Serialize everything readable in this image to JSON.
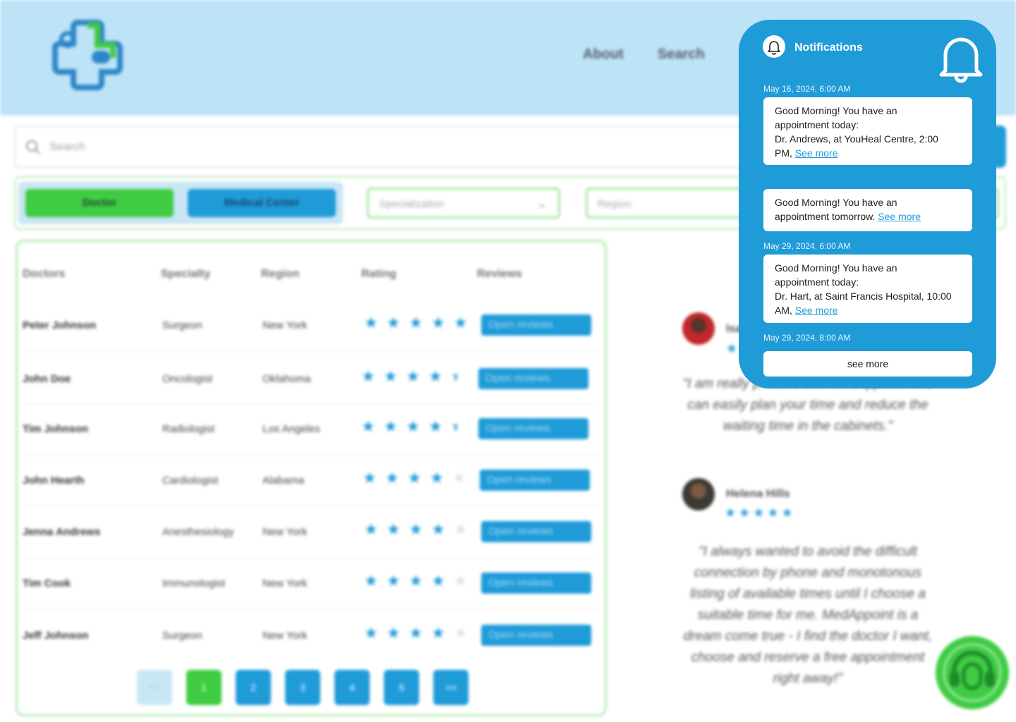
{
  "header": {
    "nav": [
      {
        "label": "About"
      },
      {
        "label": "Search"
      }
    ]
  },
  "search": {
    "placeholder": "Search"
  },
  "filters": {
    "doctor_label": "Doctor",
    "center_label": "Medical Center",
    "specialization_placeholder": "Specialization",
    "region_placeholder": "Region"
  },
  "table": {
    "headers": [
      "Doctors",
      "Specialty",
      "Region",
      "Rating",
      "Reviews"
    ],
    "rows": [
      {
        "name": "Peter Johnson",
        "specialty": "Surgeon",
        "region": "New York",
        "rating": 5,
        "button": "Open reviews"
      },
      {
        "name": "John Doe",
        "specialty": "Oncologist",
        "region": "Oklahoma",
        "rating": 4.5,
        "button": "Open reviews"
      },
      {
        "name": "Tim Johnson",
        "specialty": "Radiologist",
        "region": "Los Angeles",
        "rating": 4.5,
        "button": "Open reviews"
      },
      {
        "name": "John Hearth",
        "specialty": "Cardiologist",
        "region": "Alabama",
        "rating": 4,
        "button": "Open reviews"
      },
      {
        "name": "Jenna Andrews",
        "specialty": "Anesthesiology",
        "region": "New York",
        "rating": 4,
        "button": "Open reviews"
      },
      {
        "name": "Tim Cook",
        "specialty": "Immunologist",
        "region": "New York",
        "rating": 4,
        "button": "Open reviews"
      },
      {
        "name": "Jeff Johnson",
        "specialty": "Surgeon",
        "region": "New York",
        "rating": 4,
        "button": "Open reviews"
      }
    ],
    "pagination": [
      "<<",
      "1",
      "2",
      "3",
      "4",
      "5",
      ">>"
    ]
  },
  "testimonials": [
    {
      "name": "Isa",
      "rating": 1,
      "quote": "\"I am really pleased with MedAppoint. You can easily plan your time and reduce the waiting time in the cabinets.\""
    },
    {
      "name": "Helena Hills",
      "rating": 5,
      "quote": "\"I always wanted to avoid the difficult connection by phone and monotonous listing of available times until I choose a suitable time for me. MedAppoint is a dream come true - I find the doctor I want, choose and reserve a free appointment right away!\""
    }
  ],
  "notifications": {
    "title": "Notifications",
    "items": [
      {
        "date": "May 16, 2024, 6:00 AM",
        "lines": [
          "Good Morning! You have an",
          "appointment today:",
          "Dr. Andrews, at YouHeal Centre, 2:00",
          "PM,"
        ],
        "link": "See more"
      },
      {
        "date": "",
        "lines": [
          "Good Morning! You have an",
          "appointment tomorrow."
        ],
        "link": "See more"
      },
      {
        "date": "May 29, 2024, 6:00 AM",
        "lines": [
          "Good Morning! You have an",
          "appointment today:",
          "Dr. Hart, at Saint Francis Hospital, 10:00",
          "AM,"
        ],
        "link": "See more"
      }
    ],
    "last_date": "May 29, 2024, 8:00 AM",
    "see_more_label": "see more"
  },
  "colors": {
    "brand_blue": "#1f9bd8",
    "brand_green": "#3fcc42",
    "header_bg": "#bde3f7"
  },
  "icons": [
    "logo-cross-icon",
    "search-icon",
    "chevron-down-icon",
    "star-icon",
    "bell-icon",
    "support-headset-icon"
  ]
}
